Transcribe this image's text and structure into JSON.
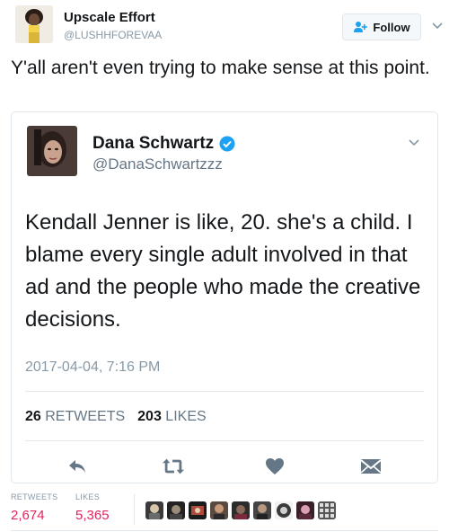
{
  "outer_tweet": {
    "name": "Upscale Effort",
    "handle": "@LUSHHFOREVAA",
    "follow_label": "Follow",
    "text": "Y'all aren't even trying to make sense at this point."
  },
  "quoted_tweet": {
    "name": "Dana Schwartz",
    "handle": "@DanaSchwartzzz",
    "verified": true,
    "text": "Kendall Jenner is like, 20. she's a child. I blame every single adult involved in that ad and the people who made the creative decisions.",
    "timestamp": "2017-04-04, 7:16 PM",
    "retweets_count": "26",
    "retweets_label": "RETWEETS",
    "likes_count": "203",
    "likes_label": "LIKES"
  },
  "engagement": {
    "retweets_label": "RETWEETS",
    "retweets_count": "2,674",
    "likes_label": "LIKES",
    "likes_count": "5,365"
  },
  "colors": {
    "verified_blue": "#1da1f2",
    "icon_gray": "#657786",
    "likes_red": "#e0245e",
    "border": "#e1e8ed"
  },
  "icons": [
    "follow-person-icon",
    "chevron-down-icon",
    "verified-badge-icon",
    "reply-icon",
    "retweet-icon",
    "like-heart-icon",
    "direct-message-icon"
  ]
}
